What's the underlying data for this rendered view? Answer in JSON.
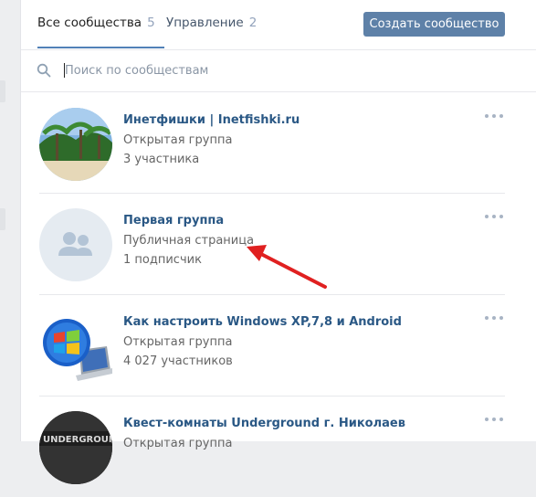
{
  "tabs": [
    {
      "label": "Все сообщества",
      "count": "5"
    },
    {
      "label": "Управление",
      "count": "2"
    }
  ],
  "create_button": "Создать сообщество",
  "search": {
    "placeholder": "Поиск по сообществам",
    "value": ""
  },
  "communities": [
    {
      "name": "Инетфишки | Inetfishki.ru",
      "type": "Открытая группа",
      "members": "3 участника",
      "avatar": "beach-palm-photo"
    },
    {
      "name": "Первая группа",
      "type": "Публичная страница",
      "members": "1 подписчик",
      "avatar": "default-group-icon"
    },
    {
      "name": "Как настроить Windows XP,7,8 и Android",
      "type": "Открытая группа",
      "members": "4 027 участников",
      "avatar": "windows-laptop-image"
    },
    {
      "name": "Квест-комнаты Underground г. Николаев",
      "type": "Открытая группа",
      "members": "",
      "avatar": "underground-logo"
    }
  ],
  "annotation": {
    "color": "#e02020",
    "target": "Публичная страница"
  },
  "colors": {
    "accent": "#5181b8",
    "button": "#5e81a8",
    "link": "#2a5885"
  }
}
